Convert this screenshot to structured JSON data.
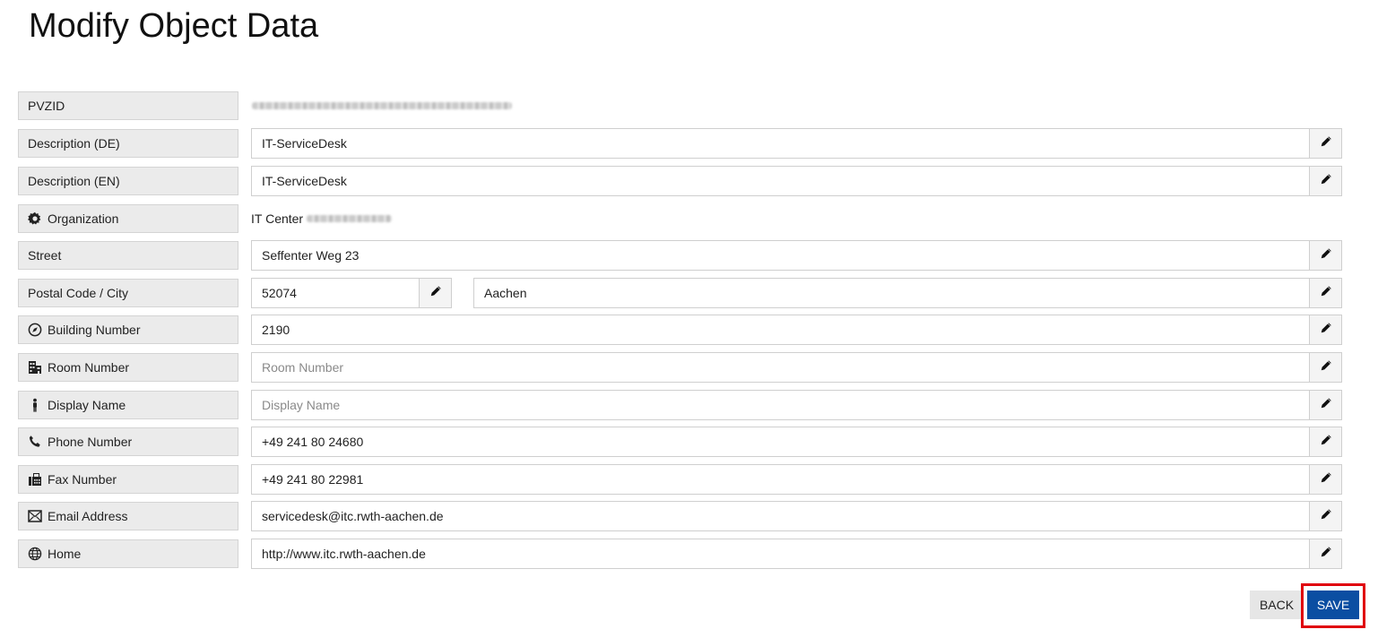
{
  "page": {
    "title": "Modify Object Data"
  },
  "rows": {
    "pvzid": {
      "label": "PVZID"
    },
    "desc_de": {
      "label": "Description (DE)",
      "value": "IT-ServiceDesk"
    },
    "desc_en": {
      "label": "Description (EN)",
      "value": "IT-ServiceDesk"
    },
    "organization": {
      "label": "Organization",
      "value": "IT Center",
      "icon": "gear-icon"
    },
    "street": {
      "label": "Street",
      "value": "Seffenter Weg 23"
    },
    "postal_city": {
      "label": "Postal Code / City",
      "postal": "52074",
      "city": "Aachen"
    },
    "building": {
      "label": "Building Number",
      "value": "2190",
      "icon": "compass-icon"
    },
    "room": {
      "label": "Room Number",
      "value": "",
      "placeholder": "Room Number",
      "icon": "building-icon"
    },
    "display": {
      "label": "Display Name",
      "value": "",
      "placeholder": "Display Name",
      "icon": "person-icon"
    },
    "phone": {
      "label": "Phone Number",
      "value": "+49 241 80 24680",
      "icon": "phone-icon"
    },
    "fax": {
      "label": "Fax Number",
      "value": "+49 241 80 22981",
      "icon": "fax-icon"
    },
    "email": {
      "label": "Email Address",
      "value": "servicedesk@itc.rwth-aachen.de",
      "icon": "envelope-icon"
    },
    "home": {
      "label": "Home",
      "value": "http://www.itc.rwth-aachen.de",
      "icon": "globe-icon"
    }
  },
  "actions": {
    "back_label": "BACK",
    "save_label": "SAVE"
  },
  "colors": {
    "save": "#0b4ea2",
    "highlight": "#e0000b",
    "label_bg": "#ebebeb"
  }
}
